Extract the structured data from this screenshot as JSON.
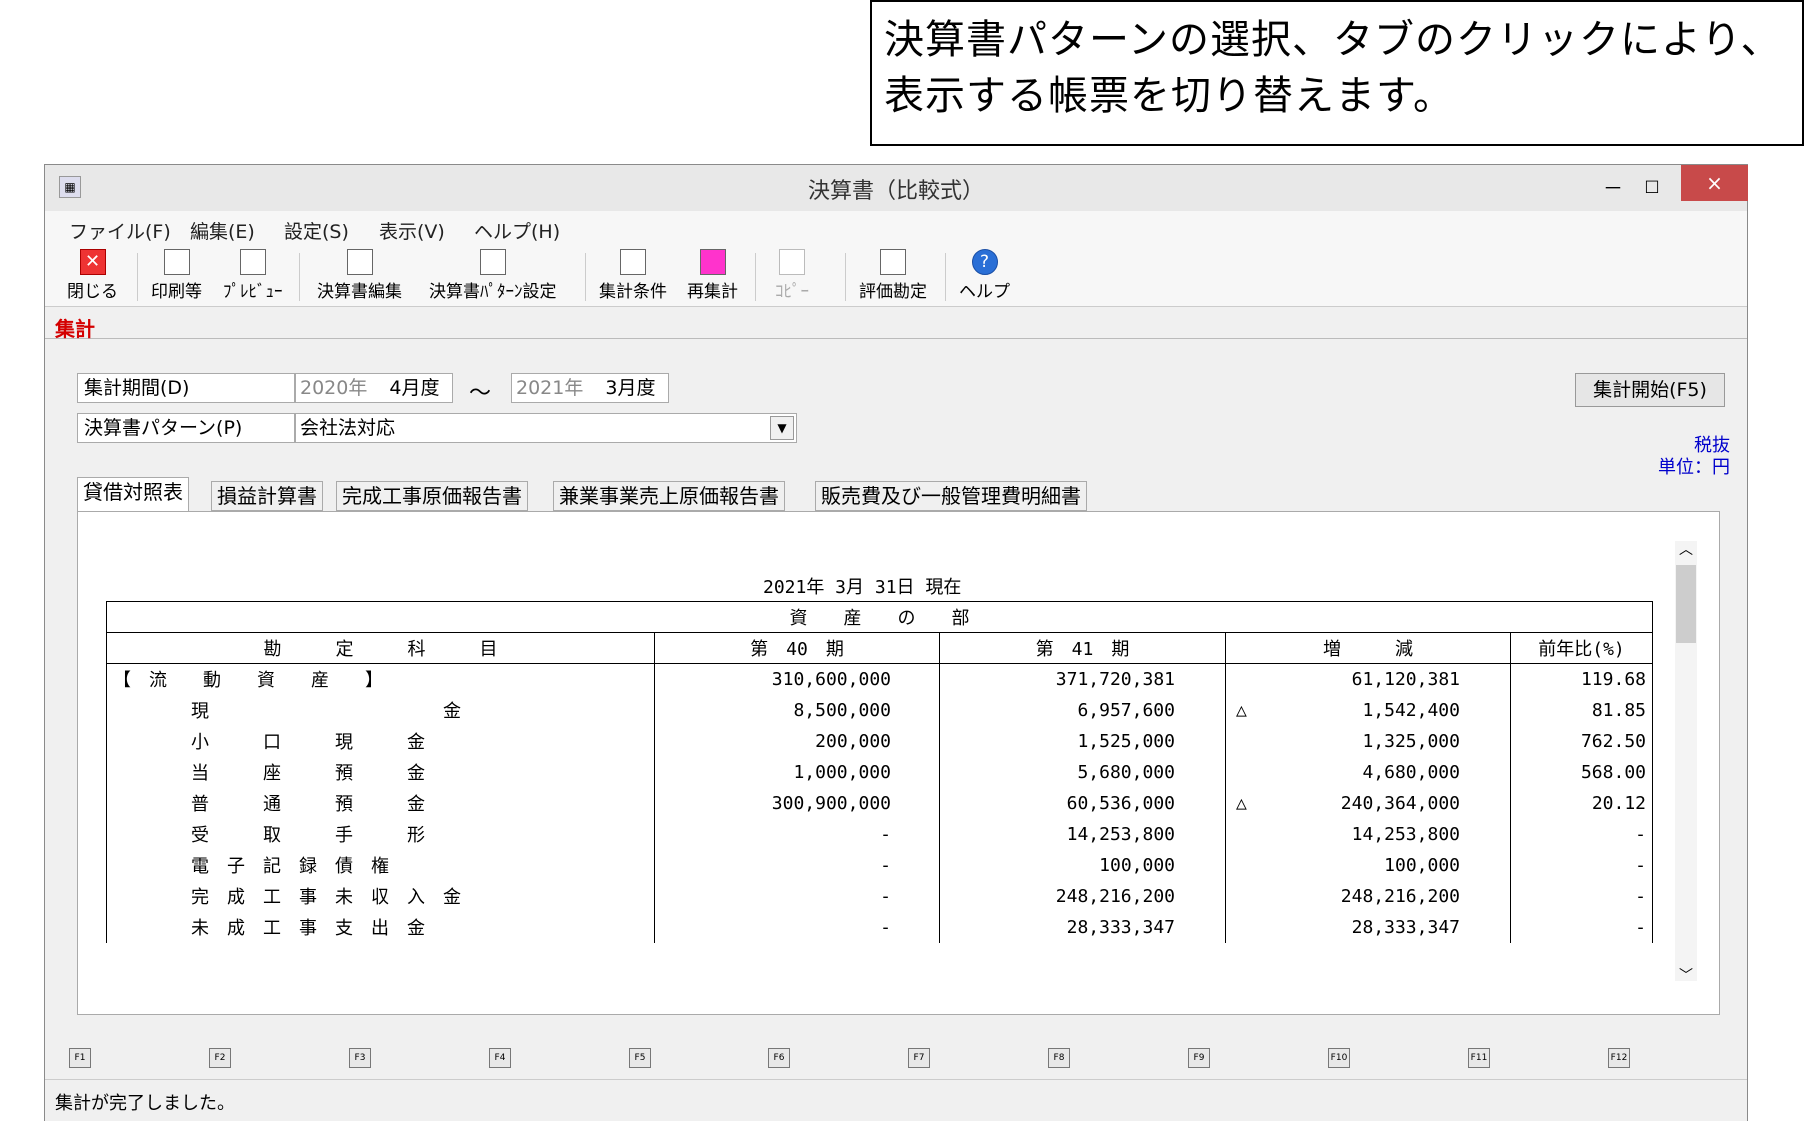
{
  "callout": {
    "line1": "決算書パターンの選択、タブのクリックにより、",
    "line2": "表示する帳票を切り替えます。"
  },
  "window": {
    "title": "決算書（比較式）",
    "close_glyph": "×",
    "min_glyph": "－",
    "max_glyph": "□"
  },
  "menu": [
    "ファイル(F)",
    "編集(E)",
    "設定(S)",
    "表示(V)",
    "ヘルプ(H)"
  ],
  "toolbar": {
    "close": "閉じる",
    "print": "印刷等",
    "preview": "ﾌﾟﾚﾋﾞｭｰ",
    "edit": "決算書編集",
    "pattern_setting": "決算書ﾊﾟﾀｰﾝ設定",
    "conditions": "集計条件",
    "recalc": "再集計",
    "copy": "ｺﾋﾟｰ",
    "evaluation": "評価勘定",
    "help": "ヘルプ"
  },
  "tab": "集計",
  "form": {
    "period_label": "集計期間(D)",
    "period_from_year": "2020年",
    "period_from_month": "4月度",
    "tilde": "～",
    "period_to_year": "2021年",
    "period_to_month": "3月度",
    "pattern_label": "決算書パターン(P)",
    "pattern_value": "会社法対応",
    "start_button": "集計開始(F5)",
    "tax": "税抜",
    "unit": "単位：円"
  },
  "report_tabs": [
    "貸借対照表",
    "損益計算書",
    "完成工事原価報告書",
    "兼業事業売上原価報告書",
    "販売費及び一般管理費明細書"
  ],
  "report": {
    "date": "2021年  3月 31日 現在",
    "section": "資　　産　　の　　部",
    "headers": [
      "勘　　　定　　　科　　　目",
      "第　40　期",
      "第　41　期",
      "増　　　減",
      "前年比(%)"
    ],
    "rows": [
      {
        "acct": "【　流　　動　　資　　産　　】",
        "p40": "310,600,000",
        "p41": "371,720,381",
        "tri": "",
        "diff": "61,120,381",
        "ratio": "119.68"
      },
      {
        "acct": "現　　　　　　　　　　　　　金",
        "p40": "8,500,000",
        "p41": "6,957,600",
        "tri": "△",
        "diff": "1,542,400",
        "ratio": "81.85"
      },
      {
        "acct": "小　　　口　　　現　　　金",
        "p40": "200,000",
        "p41": "1,525,000",
        "tri": "",
        "diff": "1,325,000",
        "ratio": "762.50"
      },
      {
        "acct": "当　　　座　　　預　　　金",
        "p40": "1,000,000",
        "p41": "5,680,000",
        "tri": "",
        "diff": "4,680,000",
        "ratio": "568.00"
      },
      {
        "acct": "普　　　通　　　預　　　金",
        "p40": "300,900,000",
        "p41": "60,536,000",
        "tri": "△",
        "diff": "240,364,000",
        "ratio": "20.12"
      },
      {
        "acct": "受　　　取　　　手　　　形",
        "p40": "-",
        "p41": "14,253,800",
        "tri": "",
        "diff": "14,253,800",
        "ratio": "-"
      },
      {
        "acct": "電　子　記　録　債　権",
        "p40": "-",
        "p41": "100,000",
        "tri": "",
        "diff": "100,000",
        "ratio": "-"
      },
      {
        "acct": "完　成　工　事　未　収　入　金",
        "p40": "-",
        "p41": "248,216,200",
        "tri": "",
        "diff": "248,216,200",
        "ratio": "-"
      },
      {
        "acct": "未　成　工　事　支　出　金",
        "p40": "-",
        "p41": "28,333,347",
        "tri": "",
        "diff": "28,333,347",
        "ratio": "-"
      }
    ]
  },
  "fkeys": [
    "F1",
    "F2",
    "F3",
    "F4",
    "F5",
    "F6",
    "F7",
    "F8",
    "F9",
    "F10",
    "F11",
    "F12"
  ],
  "status": "集計が完了しました。"
}
